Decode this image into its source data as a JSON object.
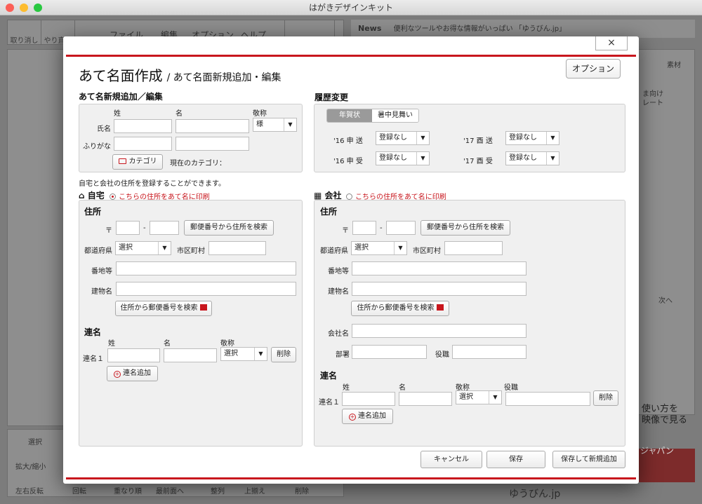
{
  "window": {
    "title": "はがきデザインキット"
  },
  "bg": {
    "undo": "取り消し",
    "redo": "やり直し",
    "menus": [
      "ファイル",
      "編集",
      "オプション",
      "ヘルプ"
    ],
    "atena_btn": "あて名面作成",
    "news_label": "News",
    "news_text": "便利なツールやお得な情報がいっぱい 「ゆうびん.jp」",
    "select_tool": "選択",
    "zoom": "拡大/縮小",
    "flip": "左右反転",
    "rotate": "回転",
    "order": "重なり順",
    "front": "最前面へ",
    "align": "整列",
    "align_top": "上揃え",
    "delete": "削除",
    "sozai": "素材",
    "tab_mukai": "ま向け",
    "tab_plate": "レート",
    "next": "次へ",
    "video1": "使い方を",
    "video2": "映像で見る",
    "japan": "ジャパン",
    "yubin": "ゆうびん.jp"
  },
  "dialog": {
    "close": "×",
    "title": "あて名面作成",
    "subtitle": "/ あて名面新規追加・編集",
    "options": "オプション",
    "new_section": {
      "title": "あて名新規追加／編集",
      "col_sei": "姓",
      "col_mei": "名",
      "col_keisho": "敬称",
      "row_name": "氏名",
      "row_kana": "ふりがな",
      "keisho_value": "様",
      "category_btn": "カテゴリ",
      "current_category": "現在のカテゴリ："
    },
    "history": {
      "title": "履歴変更",
      "tabs": [
        "年賀状",
        "暑中見舞い"
      ],
      "rows": [
        {
          "label": "'16 申  送",
          "value": "登録なし"
        },
        {
          "label": "'16 申  受",
          "value": "登録なし"
        },
        {
          "label": "'17 酉  送",
          "value": "登録なし"
        },
        {
          "label": "'17 酉  受",
          "value": "登録なし"
        }
      ]
    },
    "register_note": "自宅と会社の住所を登録することができます。",
    "home": {
      "title": "自宅",
      "print_here": "こちらの住所をあて名に印刷",
      "address_title": "住所",
      "postal_mark": "〒",
      "dash": "-",
      "search_by_postal": "郵便番号から住所を検索",
      "pref_label": "都道府県",
      "pref_value": "選択",
      "city_label": "市区町村",
      "banchi_label": "番地等",
      "building_label": "建物名",
      "search_postal": "住所から郵便番号を検索",
      "renmei_title": "連名",
      "col_sei": "姓",
      "col_mei": "名",
      "col_keisho": "敬称",
      "renmei1": "連名１",
      "keisho_value": "選択",
      "delete": "削除",
      "add_renmei": "連名追加"
    },
    "company": {
      "title": "会社",
      "print_here": "こちらの住所をあて名に印刷",
      "address_title": "住所",
      "postal_mark": "〒",
      "dash": "-",
      "search_by_postal": "郵便番号から住所を検索",
      "pref_label": "都道府県",
      "pref_value": "選択",
      "city_label": "市区町村",
      "banchi_label": "番地等",
      "building_label": "建物名",
      "search_postal": "住所から郵便番号を検索",
      "company_name": "会社名",
      "dept": "部署",
      "role": "役職",
      "renmei_title": "連名",
      "col_sei": "姓",
      "col_mei": "名",
      "col_keisho": "敬称",
      "col_role": "役職",
      "renmei1": "連名１",
      "keisho_value": "選択",
      "delete": "削除",
      "add_renmei": "連名追加"
    },
    "footer": {
      "cancel": "キャンセル",
      "save": "保存",
      "save_new": "保存して新規追加"
    }
  },
  "colors": {
    "accent": "#c8161d"
  }
}
